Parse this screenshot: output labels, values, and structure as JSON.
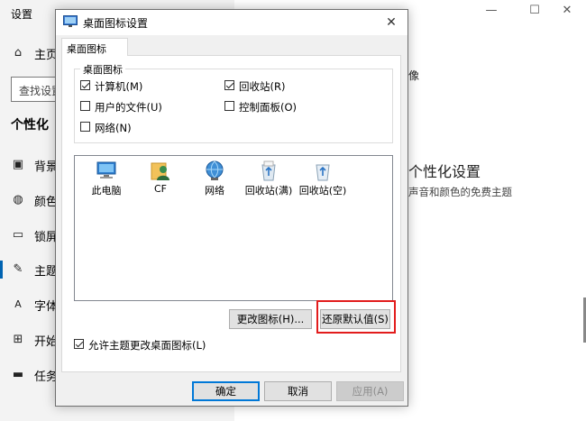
{
  "settings": {
    "app_title": "设置",
    "search_placeholder": "查找设置",
    "home_label": "主页",
    "section_title": "个性化",
    "nav": [
      {
        "label": "背景",
        "icon": "image-icon"
      },
      {
        "label": "颜色",
        "icon": "palette-icon"
      },
      {
        "label": "锁屏",
        "icon": "lock-screen-icon"
      },
      {
        "label": "主题",
        "icon": "brush-icon"
      },
      {
        "label": "字体",
        "icon": "font-icon"
      },
      {
        "label": "开始",
        "icon": "start-menu-icon"
      },
      {
        "label": "任务",
        "icon": "taskbar-icon"
      }
    ],
    "selected_nav": "主题",
    "right": {
      "top_text": "像",
      "heading": "个性化设置",
      "subtext": "声音和颜色的免费主题"
    },
    "window_controls": [
      "—",
      "☐",
      "✕"
    ]
  },
  "dialog": {
    "title": "桌面图标设置",
    "close_glyph": "✕",
    "tab_label": "桌面图标",
    "group_label": "桌面图标",
    "checkboxes": [
      {
        "label": "计算机(M)",
        "checked": true
      },
      {
        "label": "回收站(R)",
        "checked": true
      },
      {
        "label": "用户的文件(U)",
        "checked": false
      },
      {
        "label": "控制面板(O)",
        "checked": false
      },
      {
        "label": "网络(N)",
        "checked": false
      }
    ],
    "icons": [
      {
        "label": "此电脑",
        "icon": "computer-icon"
      },
      {
        "label": "CF",
        "icon": "user-folder-icon"
      },
      {
        "label": "网络",
        "icon": "network-icon"
      },
      {
        "label": "回收站(满)",
        "icon": "recycle-bin-full-icon"
      },
      {
        "label": "回收站(空)",
        "icon": "recycle-bin-empty-icon"
      }
    ],
    "change_icon_button": "更改图标(H)...",
    "restore_default_button": "还原默认值(S)",
    "allow_themes_checkbox": {
      "label": "允许主题更改桌面图标(L)",
      "checked": true
    },
    "ok_button": "确定",
    "cancel_button": "取消",
    "apply_button": "应用(A)"
  },
  "colors": {
    "accent": "#0078d7",
    "highlight": "#e21c1c"
  }
}
